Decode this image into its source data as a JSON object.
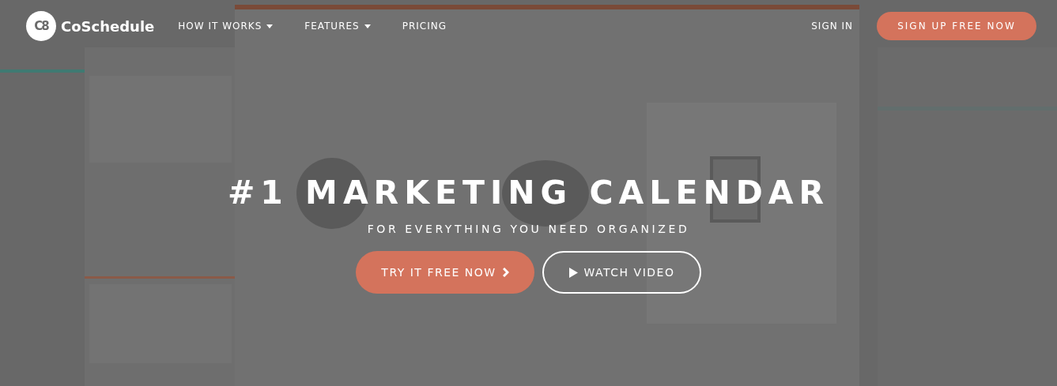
{
  "header": {
    "logo": {
      "mark": "C8",
      "name": "CoSchedule"
    },
    "nav": [
      {
        "label": "HOW IT WORKS",
        "dropdown": true
      },
      {
        "label": "FEATURES",
        "dropdown": true
      },
      {
        "label": "PRICING",
        "dropdown": false
      }
    ],
    "sign_in": "SIGN IN",
    "sign_up": "SIGN UP FREE NOW"
  },
  "hero": {
    "title": "#1 MARKETING CALENDAR",
    "subtitle": "FOR EVERYTHING YOU NEED ORGANIZED",
    "buttons": [
      {
        "kind": "primary",
        "label": "TRY IT FREE NOW"
      },
      {
        "kind": "outline",
        "label": "WATCH VIDEO"
      }
    ]
  }
}
